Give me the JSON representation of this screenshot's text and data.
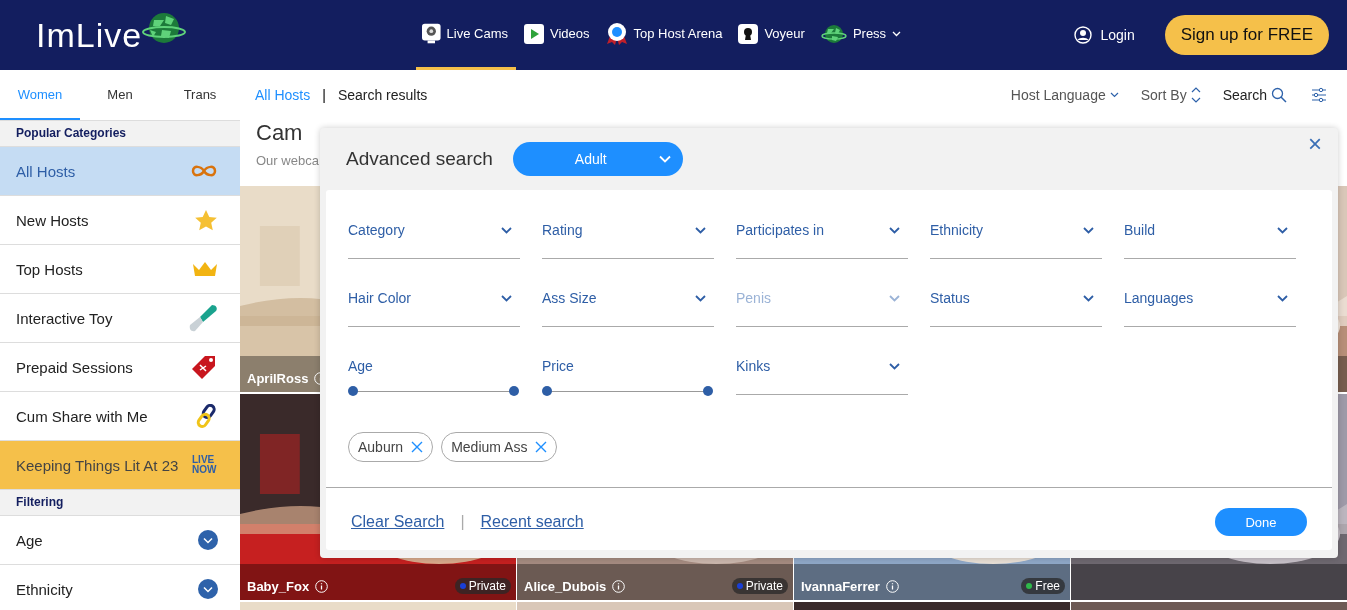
{
  "header": {
    "logo": "ImLive",
    "nav": [
      {
        "label": "Live Cams",
        "selected": true,
        "caret": false
      },
      {
        "label": "Videos",
        "selected": false,
        "caret": false
      },
      {
        "label": "Top Host Arena",
        "selected": false,
        "caret": false
      },
      {
        "label": "Voyeur",
        "selected": false,
        "caret": false
      },
      {
        "label": "Press",
        "selected": false,
        "caret": true
      }
    ],
    "login": "Login",
    "signup": "Sign up for FREE"
  },
  "sidebar": {
    "tabs": [
      {
        "label": "Women",
        "selected": true
      },
      {
        "label": "Men",
        "selected": false
      },
      {
        "label": "Trans",
        "selected": false
      }
    ],
    "sections": [
      {
        "title": "Popular Categories",
        "items": [
          {
            "kind": "category",
            "label": "All Hosts",
            "selected": true
          },
          {
            "kind": "category",
            "label": "New Hosts",
            "selected": false
          },
          {
            "kind": "category",
            "label": "Top Hosts",
            "selected": false
          },
          {
            "kind": "category",
            "label": "Interactive Toy",
            "selected": false
          },
          {
            "kind": "category",
            "label": "Prepaid Sessions",
            "selected": false
          },
          {
            "kind": "category",
            "label": "Cum Share with Me",
            "selected": false
          },
          {
            "kind": "promo",
            "label": "Keeping Things Lit At 23",
            "badge": "LIVE NOW",
            "selected": false
          }
        ]
      },
      {
        "title": "Filtering",
        "items": [
          {
            "kind": "filter",
            "label": "Age",
            "selected": false
          },
          {
            "kind": "filter",
            "label": "Ethnicity",
            "selected": false
          }
        ]
      }
    ]
  },
  "breadcrumb": {
    "link": "All Hosts",
    "separator": "|",
    "current": "Search results"
  },
  "toolbar": {
    "language": "Host Language",
    "sort": "Sort By",
    "search": "Search"
  },
  "title": "Cam",
  "subtitle": "Our webca",
  "thumbnails": [
    {
      "kind": "picture",
      "name": "AprilRoss"
    },
    {
      "kind": "picture"
    },
    {
      "kind": "picture",
      "name": "Baby_Fox",
      "status": "Private",
      "color": "#1a3fd6"
    },
    {
      "kind": "picture",
      "name": "Alice_Dubois",
      "status": "Private",
      "color": "#1a3fd6"
    },
    {
      "kind": "picture",
      "name": "IvannaFerrer",
      "status": "Free",
      "color": "#2fb84a"
    },
    {
      "kind": "picture"
    },
    {
      "kind": "picture"
    },
    {
      "kind": "picture"
    },
    {
      "kind": "picture"
    },
    {
      "kind": "picture"
    }
  ],
  "advanced_search": {
    "title": "Advanced search",
    "mode": "Adult",
    "close": "×",
    "fields": [
      {
        "kind": "select",
        "label": "Category",
        "disabled": false
      },
      {
        "kind": "select",
        "label": "Rating",
        "disabled": false
      },
      {
        "kind": "select",
        "label": "Participates in",
        "disabled": false
      },
      {
        "kind": "select",
        "label": "Ethnicity",
        "disabled": false
      },
      {
        "kind": "select",
        "label": "Build",
        "disabled": false
      },
      {
        "kind": "select",
        "label": "Hair Color",
        "disabled": false
      },
      {
        "kind": "select",
        "label": "Ass Size",
        "disabled": false
      },
      {
        "kind": "select",
        "label": "Penis",
        "disabled": true
      },
      {
        "kind": "select",
        "label": "Status",
        "disabled": false
      },
      {
        "kind": "select",
        "label": "Languages",
        "disabled": false
      },
      {
        "kind": "range",
        "label": "Age",
        "disabled": false
      },
      {
        "kind": "range",
        "label": "Price",
        "disabled": false
      },
      {
        "kind": "select",
        "label": "Kinks",
        "disabled": false
      }
    ],
    "chips": [
      "Auburn",
      "Medium Ass"
    ],
    "clear": "Clear Search",
    "separator": "|",
    "recent": "Recent search",
    "done": "Done"
  }
}
